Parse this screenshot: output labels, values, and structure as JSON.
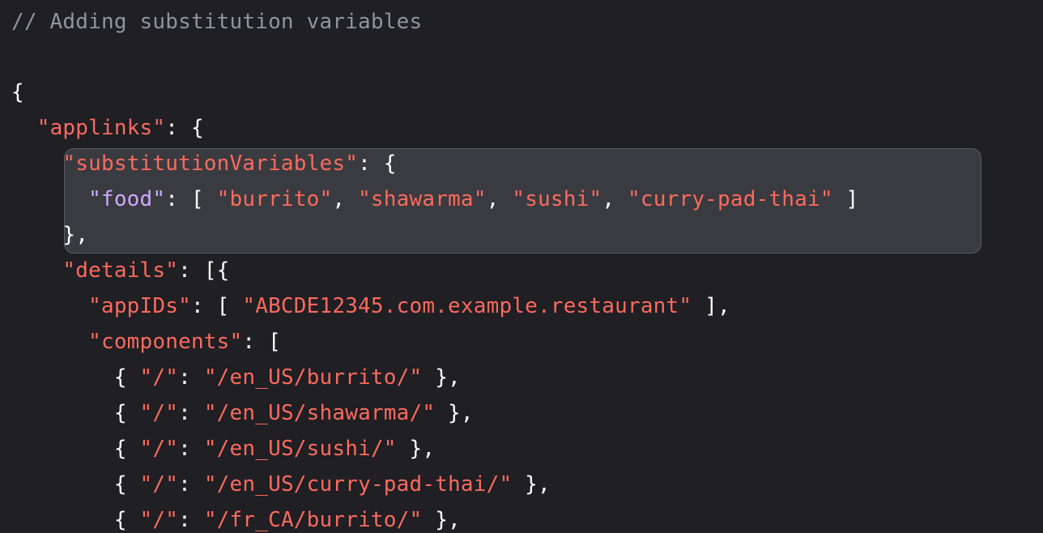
{
  "comment": "// Adding substitution variables",
  "open_brace": "{",
  "applinks_key": "\"applinks\"",
  "applinks_rest": ": {",
  "subvars_key": "\"substitutionVariables\"",
  "subvars_rest": ": {",
  "food_key": "\"food\"",
  "food_open": ": [ ",
  "food_values": [
    "\"burrito\"",
    "\"shawarma\"",
    "\"sushi\"",
    "\"curry-pad-thai\""
  ],
  "comma_sep": ", ",
  "food_close": " ]",
  "subvars_close": "},",
  "details_key": "\"details\"",
  "details_rest": ": [{",
  "appids_key": "\"appIDs\"",
  "appids_open": ": [ ",
  "appids_value": "\"ABCDE12345.com.example.restaurant\"",
  "appids_close": " ],",
  "components_key": "\"components\"",
  "components_rest": ": [",
  "component_open": "{ ",
  "component_key": "\"/\"",
  "component_colon": ": ",
  "component_close": " },",
  "components": [
    "\"/en_US/burrito/\"",
    "\"/en_US/shawarma/\"",
    "\"/en_US/sushi/\"",
    "\"/en_US/curry-pad-thai/\"",
    "\"/fr_CA/burrito/\""
  ]
}
